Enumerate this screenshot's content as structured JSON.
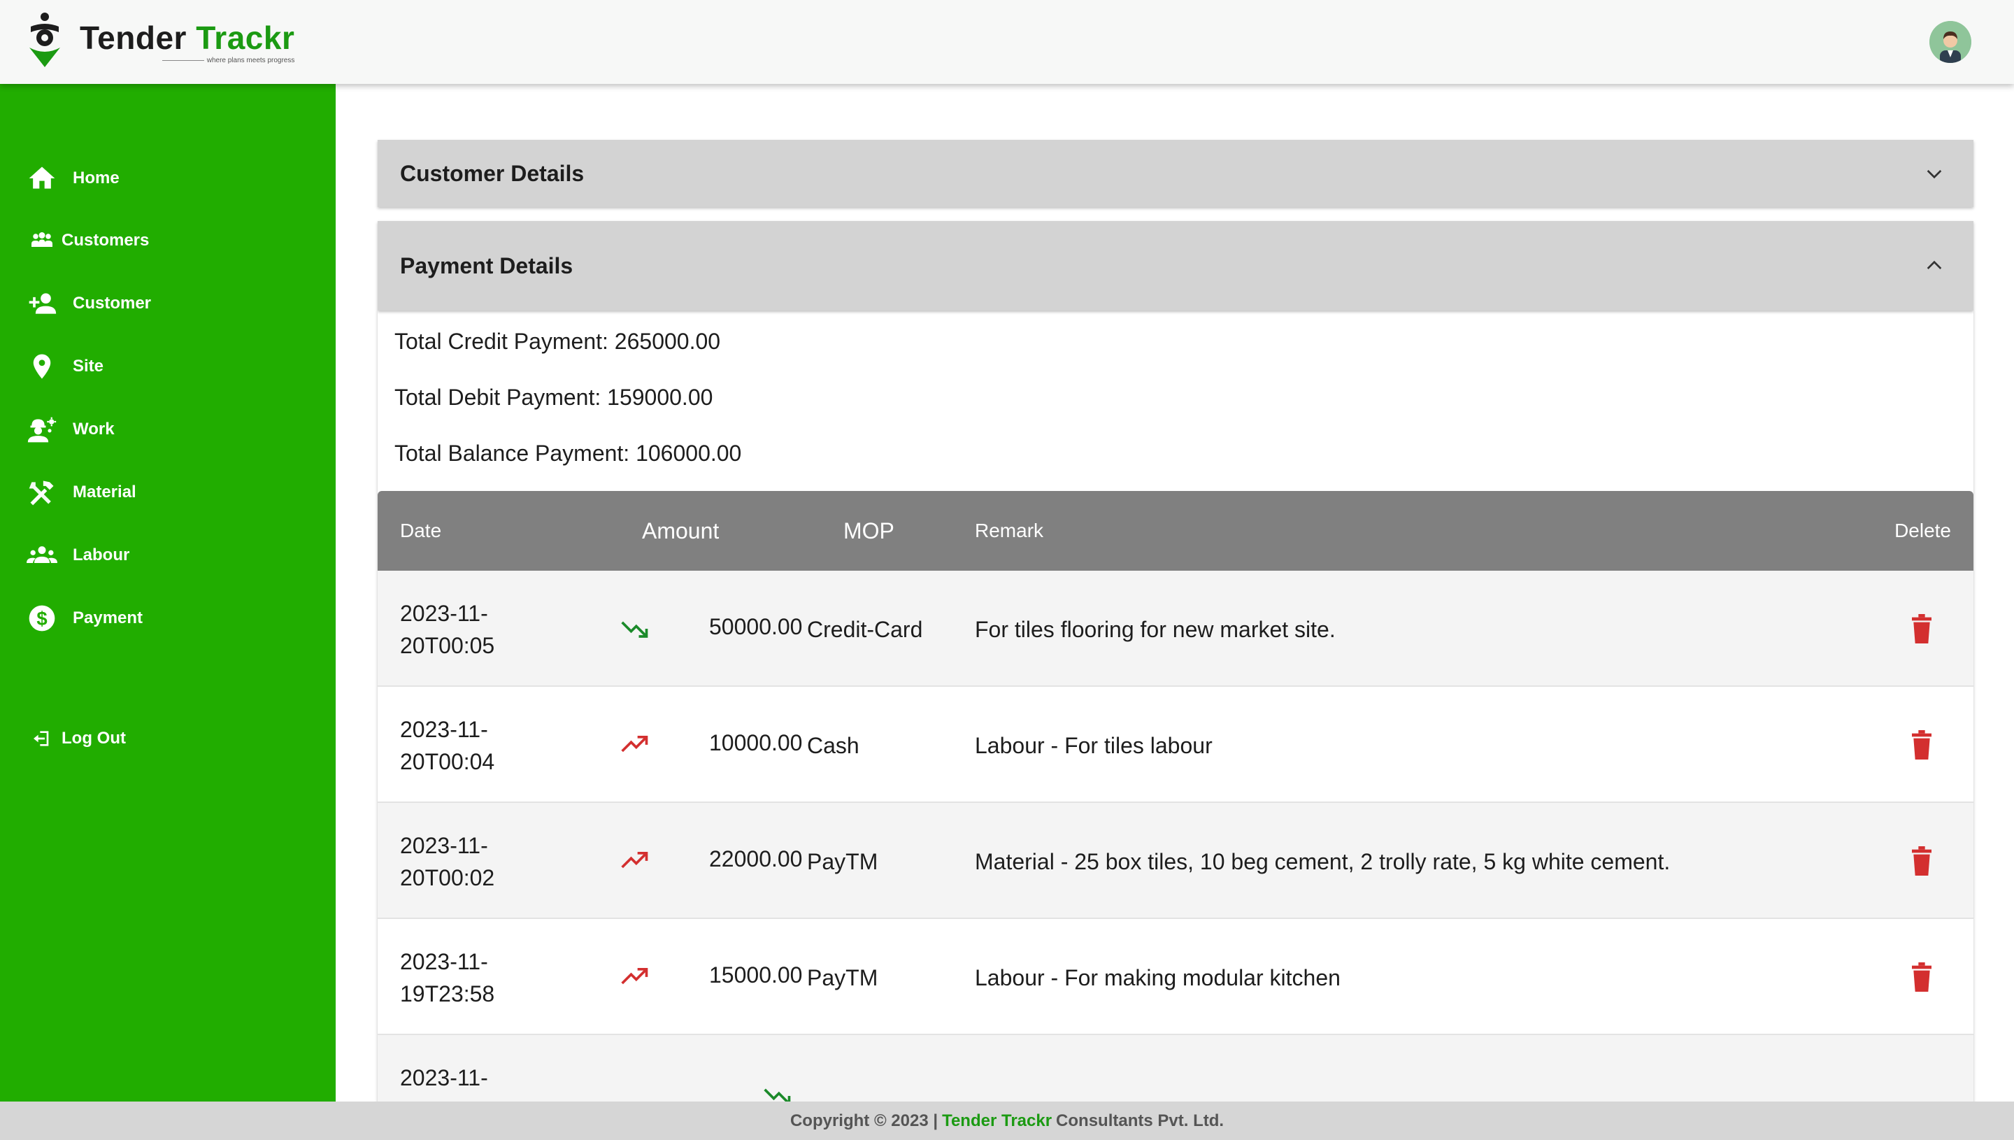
{
  "header": {
    "logo_main": "Tender ",
    "logo_accent": "Trackr",
    "tagline": "where plans meets progress",
    "avatar_icon": "user-avatar-icon"
  },
  "sidebar": {
    "items": [
      {
        "label": "Home",
        "icon": "home-icon"
      },
      {
        "label": "Customers",
        "icon": "group-icon"
      },
      {
        "label": "Customer",
        "icon": "person-add-icon"
      },
      {
        "label": "Site",
        "icon": "location-pin-icon"
      },
      {
        "label": "Work",
        "icon": "engineer-icon"
      },
      {
        "label": "Material",
        "icon": "tools-icon"
      },
      {
        "label": "Labour",
        "icon": "groups-icon"
      },
      {
        "label": "Payment",
        "icon": "dollar-icon"
      }
    ],
    "logout": {
      "label": "Log Out",
      "icon": "logout-icon"
    },
    "background": "#21ad00"
  },
  "customer_details": {
    "title": "Customer Details",
    "expanded": false
  },
  "payment_details": {
    "title": "Payment Details",
    "expanded": true,
    "totals": {
      "credit": "Total Credit Payment: 265000.00",
      "debit": "Total Debit Payment: 159000.00",
      "balance": "Total Balance Payment: 106000.00"
    },
    "table": {
      "headers": {
        "date": "Date",
        "amount": "Amount",
        "mop": "MOP",
        "remark": "Remark",
        "delete": "Delete"
      },
      "rows": [
        {
          "date_line1": "2023-11-",
          "date_line2": "20T00:05",
          "trend": "trending-down-icon",
          "amount": "50000.00",
          "mop": "Credit-Card",
          "remark": "For tiles flooring for new market site."
        },
        {
          "date_line1": "2023-11-",
          "date_line2": "20T00:04",
          "trend": "trending-up-icon",
          "amount": "10000.00",
          "mop": "Cash",
          "remark": "Labour - For tiles labour"
        },
        {
          "date_line1": "2023-11-",
          "date_line2": "20T00:02",
          "trend": "trending-up-icon",
          "amount": "22000.00",
          "mop": "PayTM",
          "remark": "Material - 25 box tiles, 10 beg cement, 2 trolly rate, 5 kg white cement."
        },
        {
          "date_line1": "2023-11-",
          "date_line2": "19T23:58",
          "trend": "trending-up-icon",
          "amount": "15000.00",
          "mop": "PayTM",
          "remark": "Labour - For making modular kitchen"
        },
        {
          "date_line1": "2023-11-",
          "date_line2": "",
          "trend": "trending-down-icon",
          "amount": "",
          "mop": "",
          "remark": ""
        }
      ]
    }
  },
  "footer": {
    "prefix": "Copyright © 2023 | ",
    "brand": "Tender Trackr",
    "suffix": " Consultants Pvt. Ltd."
  },
  "colors": {
    "brand_green": "#21ad00",
    "trend_down": "#1b8a2a",
    "trend_up": "#d32f2f",
    "delete": "#d32f2f"
  }
}
